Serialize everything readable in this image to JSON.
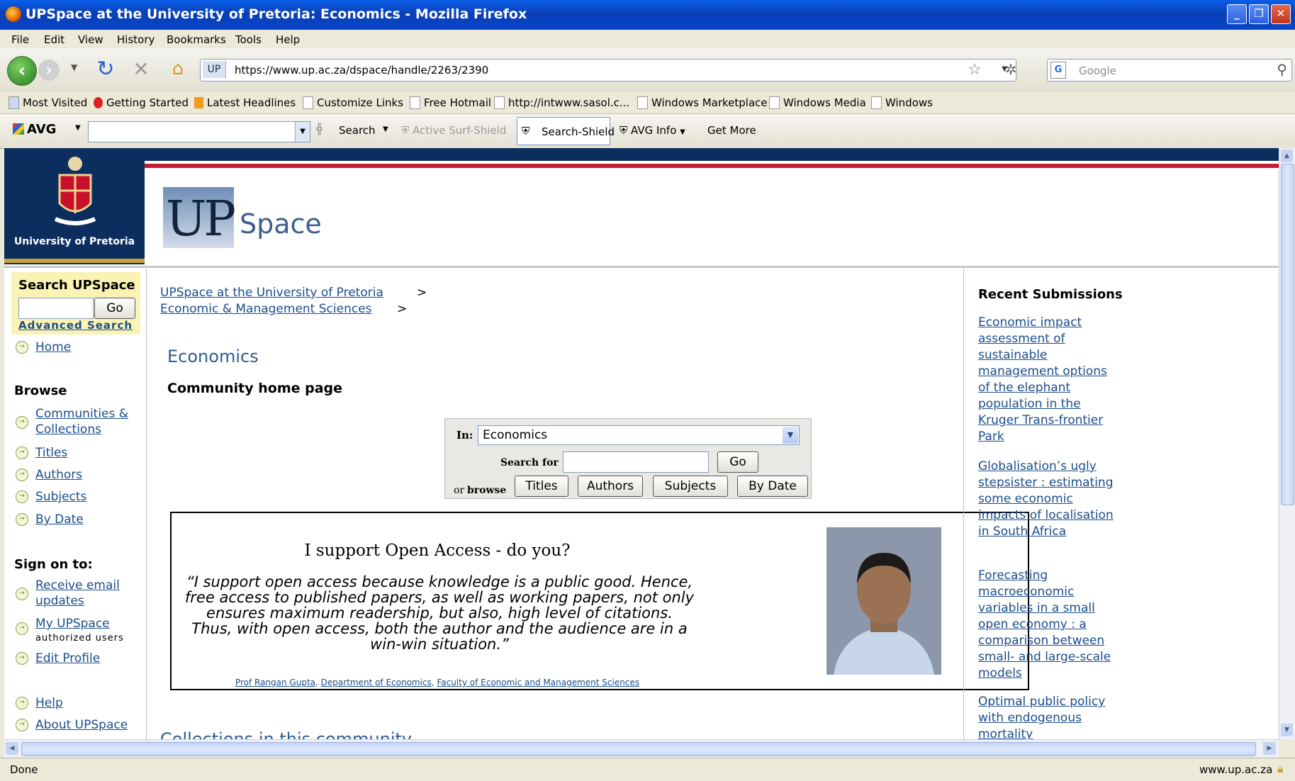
{
  "window": {
    "title": "UPSpace at the University of Pretoria: Economics - Mozilla Firefox",
    "controls": {
      "minimize": "_",
      "restore": "❐",
      "close": "✕"
    }
  },
  "menu": [
    "File",
    "Edit",
    "View",
    "History",
    "Bookmarks",
    "Tools",
    "Help"
  ],
  "nav": {
    "url": "https://www.up.ac.za/dspace/handle/2263/2390",
    "site_badge": "UP",
    "search_placeholder": "Google",
    "search_engine_badge": "G"
  },
  "bookmarks": [
    "Most Visited",
    "Getting Started",
    "Latest Headlines",
    "Customize Links",
    "Free Hotmail",
    "http://intwww.sasol.c...",
    "Windows Marketplace",
    "Windows Media",
    "Windows"
  ],
  "avg": {
    "brand": "AVG",
    "search": "Search",
    "surf_shield": "Active Surf-Shield",
    "search_shield": "Search-Shield",
    "info": "AVG Info",
    "get_more": "Get More"
  },
  "page": {
    "university_label": "University of Pretoria",
    "logo_up": "UP",
    "logo_space": "Space",
    "sidebar": {
      "search_heading": "Search UPSpace",
      "go": "Go",
      "advanced": "Advanced Search",
      "home": "Home",
      "browse_heading": "Browse",
      "browse_links": [
        "Communities & Collections",
        "Titles",
        "Authors",
        "Subjects",
        "By Date"
      ],
      "signon_heading": "Sign on to:",
      "receive_email": "Receive email updates",
      "my_upspace": "My UPSpace",
      "authorized_users": "authorized users",
      "edit_profile": "Edit Profile",
      "help": "Help",
      "about": "About UPSpace"
    },
    "breadcrumbs": [
      "UPSpace at the University of Pretoria",
      "Economic & Management Sciences"
    ],
    "breadcrumb_sep": ">",
    "community_title": "Economics",
    "community_subtitle": "Community home page",
    "search_widget": {
      "in_label": "In:",
      "scope": "Economics",
      "search_for": "Search for",
      "go": "Go",
      "or": "or",
      "browse": "browse",
      "buttons": [
        "Titles",
        "Authors",
        "Subjects",
        "By Date"
      ]
    },
    "open_access": {
      "heading": "I support Open Access - do you?",
      "quote": "“I support open access because knowledge is a public good. Hence, free access to published papers, as well as working papers, not only ensures maximum readership, but also, high level of citations. Thus, with open access, both the author and the audience are in a win-win situation.”",
      "credit_1": "Prof Rangan Gupta",
      "credit_2": "Department of Economics",
      "credit_3": "Faculty of Economic and Management Sciences"
    },
    "collections_heading": "Collections in this community",
    "recent": {
      "heading": "Recent Submissions",
      "items": [
        "Economic impact assessment of sustainable management options of the elephant population in the Kruger Trans-frontier Park",
        "Globalisation’s ugly stepsister : estimating some economic impacts of localisation in South Africa",
        "Forecasting macroeconomic variables in a small open economy : a comparison between small- and large-scale models",
        "Optimal public policy with endogenous mortality"
      ]
    }
  },
  "status": {
    "left": "Done",
    "right": "www.up.ac.za"
  }
}
